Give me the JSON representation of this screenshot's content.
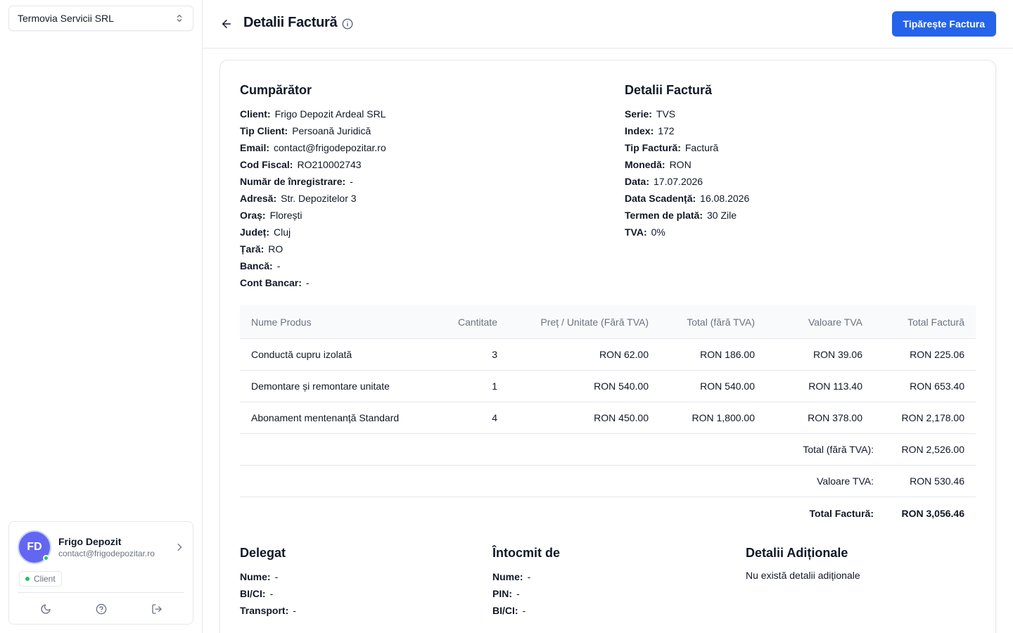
{
  "sidebar": {
    "company": "Termovia Servicii SRL",
    "user": {
      "initials": "FD",
      "name": "Frigo Depozit",
      "email": "contact@frigodepozitar.ro",
      "role": "Client"
    },
    "icons": [
      "chevron-up-down-icon",
      "chevron-right-icon",
      "moon-icon",
      "help-circle-icon",
      "logout-icon"
    ]
  },
  "header": {
    "title": "Detalii Factură",
    "print_label": "Tipărește Factura"
  },
  "buyer": {
    "title": "Cumpărător",
    "fields": [
      {
        "k": "Client:",
        "v": "Frigo Depozit Ardeal SRL"
      },
      {
        "k": "Tip Client:",
        "v": "Persoană Juridică"
      },
      {
        "k": "Email:",
        "v": "contact@frigodepozitar.ro"
      },
      {
        "k": "Cod Fiscal:",
        "v": "RO210002743"
      },
      {
        "k": "Număr de înregistrare:",
        "v": "-"
      },
      {
        "k": "Adresă:",
        "v": "Str. Depozitelor 3"
      },
      {
        "k": "Oraș:",
        "v": "Florești"
      },
      {
        "k": "Județ:",
        "v": "Cluj"
      },
      {
        "k": "Țară:",
        "v": "RO"
      },
      {
        "k": "Bancă:",
        "v": "-"
      },
      {
        "k": "Cont Bancar:",
        "v": "-"
      }
    ]
  },
  "invoice": {
    "title": "Detalii Factură",
    "fields": [
      {
        "k": "Serie:",
        "v": "TVS"
      },
      {
        "k": "Index:",
        "v": "172"
      },
      {
        "k": "Tip Factură:",
        "v": "Factură"
      },
      {
        "k": "Monedă:",
        "v": "RON"
      },
      {
        "k": "Data:",
        "v": "17.07.2026"
      },
      {
        "k": "Data Scadență:",
        "v": "16.08.2026"
      },
      {
        "k": "Termen de plată:",
        "v": "30 Zile"
      },
      {
        "k": "TVA:",
        "v": "0%"
      }
    ]
  },
  "table": {
    "headers": [
      "Nume Produs",
      "Cantitate",
      "Preț / Unitate (Fără TVA)",
      "Total (fără TVA)",
      "Valoare TVA",
      "Total Factură"
    ],
    "rows": [
      [
        "Conductă cupru izolată",
        "3",
        "RON 62.00",
        "RON 186.00",
        "RON 39.06",
        "RON 225.06"
      ],
      [
        "Demontare și remontare unitate",
        "1",
        "RON 540.00",
        "RON 540.00",
        "RON 113.40",
        "RON 653.40"
      ],
      [
        "Abonament mentenanță Standard",
        "4",
        "RON 450.00",
        "RON 1,800.00",
        "RON 378.00",
        "RON 2,178.00"
      ]
    ],
    "summary": [
      {
        "label": "Total (fără TVA):",
        "value": "RON 2,526.00"
      },
      {
        "label": "Valoare TVA:",
        "value": "RON 530.46"
      },
      {
        "label": "Total Factură:",
        "value": "RON 3,056.46"
      }
    ]
  },
  "delegate": {
    "title": "Delegat",
    "fields": [
      {
        "k": "Nume:",
        "v": "-"
      },
      {
        "k": "BI/CI:",
        "v": "-"
      },
      {
        "k": "Transport:",
        "v": "-"
      }
    ]
  },
  "issuer": {
    "title": "Întocmit de",
    "fields": [
      {
        "k": "Nume:",
        "v": "-"
      },
      {
        "k": "PIN:",
        "v": "-"
      },
      {
        "k": "BI/CI:",
        "v": "-"
      }
    ]
  },
  "additional": {
    "title": "Detalii Adiționale",
    "text": "Nu există detalii adiționale"
  },
  "colors": {
    "primary": "#2563eb",
    "avatar": "#6366f1",
    "online": "#22c55e",
    "border": "#e5e7eb"
  }
}
